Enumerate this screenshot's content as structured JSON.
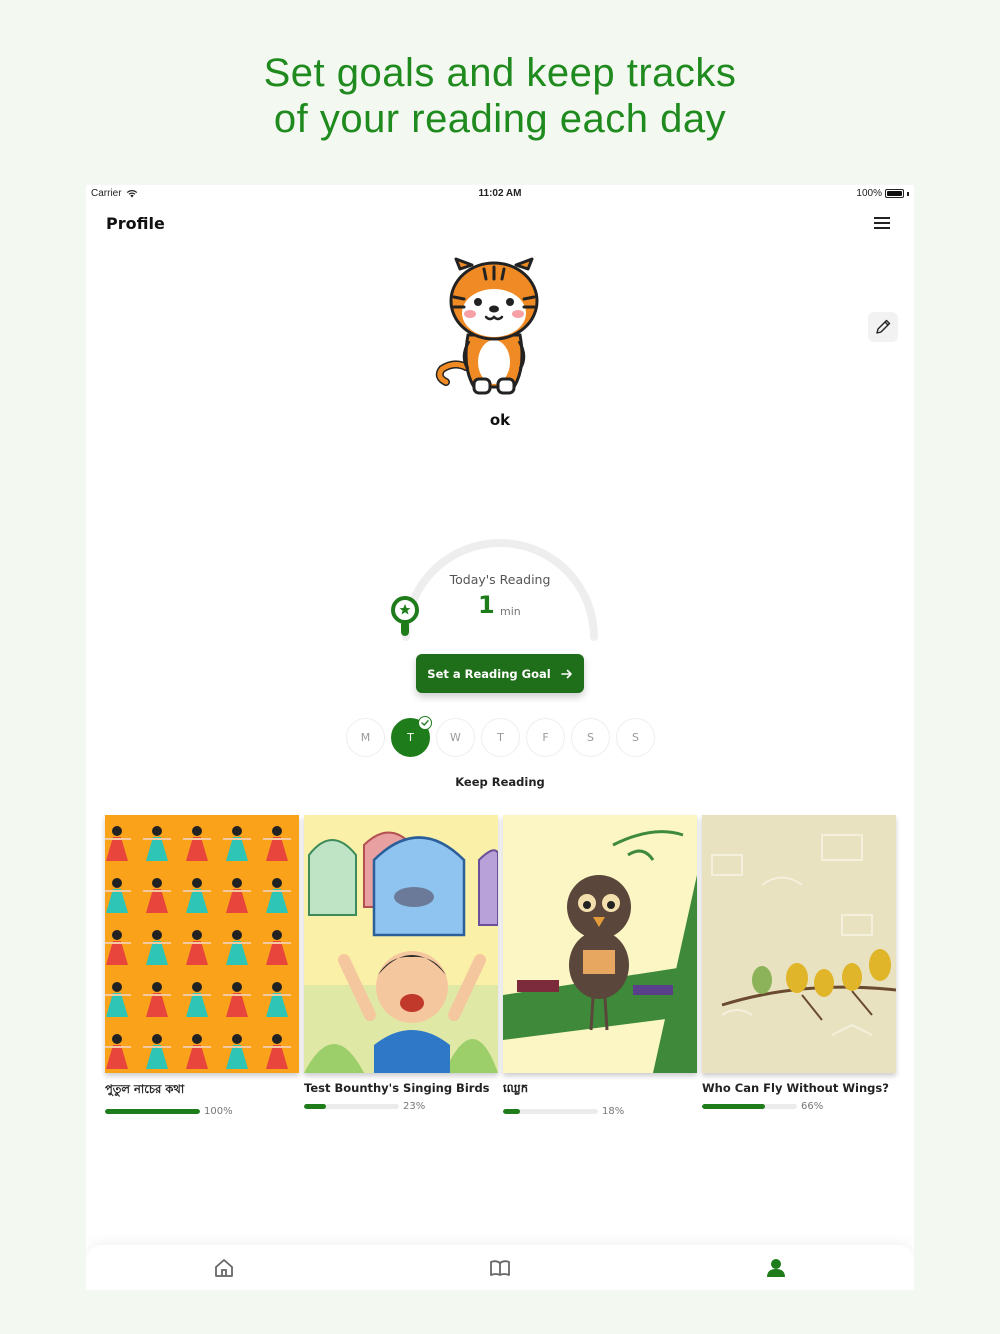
{
  "headline": {
    "line1": "Set goals and keep tracks",
    "line2": "of your reading each day"
  },
  "status_bar": {
    "carrier": "Carrier",
    "time": "11:02 AM",
    "battery": "100%"
  },
  "header": {
    "title": "Profile"
  },
  "profile": {
    "username": "ok"
  },
  "reading": {
    "label": "Today's Reading",
    "value": "1",
    "unit": "min"
  },
  "goal_button": {
    "label": "Set a Reading Goal"
  },
  "days": [
    {
      "letter": "M",
      "active": false
    },
    {
      "letter": "T",
      "active": true
    },
    {
      "letter": "W",
      "active": false
    },
    {
      "letter": "T",
      "active": false
    },
    {
      "letter": "F",
      "active": false
    },
    {
      "letter": "S",
      "active": false
    },
    {
      "letter": "S",
      "active": false
    }
  ],
  "keep_reading": {
    "label": "Keep Reading"
  },
  "books": [
    {
      "title": "পুতুল নাচের কথা",
      "progress": 1.0,
      "percent_label": "100%"
    },
    {
      "title": "Test Bounthy's Singing Birds",
      "progress": 0.23,
      "percent_label": "23%"
    },
    {
      "title": "ឈ្លេក",
      "progress": 0.18,
      "percent_label": "18%"
    },
    {
      "title": "Who Can Fly Without Wings?",
      "progress": 0.66,
      "percent_label": "66%"
    }
  ],
  "colors": {
    "brand_green": "#1e7d1a",
    "headline_green": "#1f8a1d"
  },
  "tabs": [
    {
      "icon": "home-icon",
      "active": false
    },
    {
      "icon": "book-open-icon",
      "active": false
    },
    {
      "icon": "user-icon",
      "active": true
    }
  ]
}
